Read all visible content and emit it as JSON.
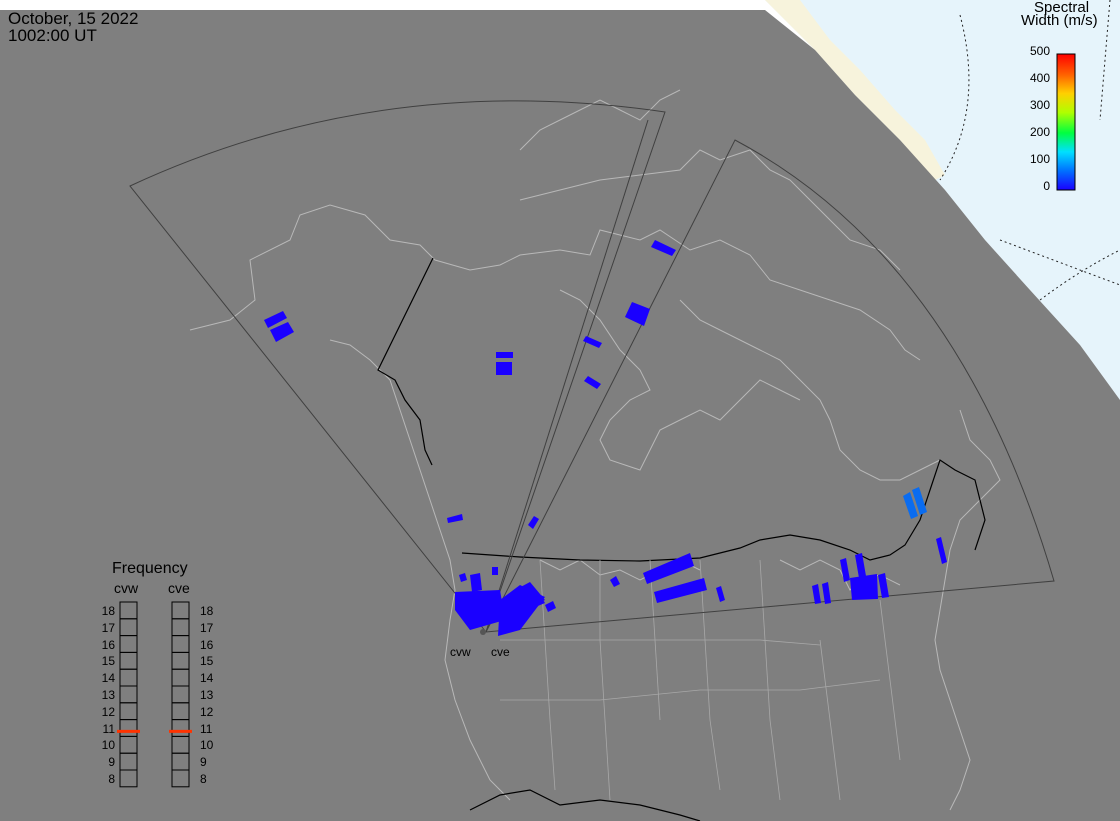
{
  "header": {
    "date": "October, 15 2022",
    "time": "1002:00 UT"
  },
  "colorbar": {
    "title_line1": "Spectral",
    "title_line2": "Width (m/s)",
    "ticks": [
      "500",
      "400",
      "300",
      "200",
      "100",
      "0"
    ],
    "min": 0,
    "max": 500,
    "colors": [
      "#1a00ff",
      "#0070ff",
      "#00e0ff",
      "#00ff40",
      "#b0ff00",
      "#ffd000",
      "#ff6000",
      "#ff0000"
    ]
  },
  "frequency_panel": {
    "title": "Frequency",
    "radars": [
      "cvw",
      "cve"
    ],
    "ticks": [
      "18",
      "17",
      "16",
      "15",
      "14",
      "13",
      "12",
      "11",
      "10",
      "9",
      "8"
    ],
    "values": [
      10.8,
      10.8
    ],
    "marker_color": "#ff3300"
  },
  "radar_sites": [
    "cvw",
    "cve"
  ],
  "colors": {
    "map_background": "#7f7f7f",
    "ocean_polar": "#e6f4fb",
    "land_polar": "#f7f3dc",
    "coastline": "#b8b8b8",
    "border": "#000000",
    "fov_outline": "#404040",
    "echo": "#1a00ff",
    "echo_high": "#0a6cf0"
  }
}
